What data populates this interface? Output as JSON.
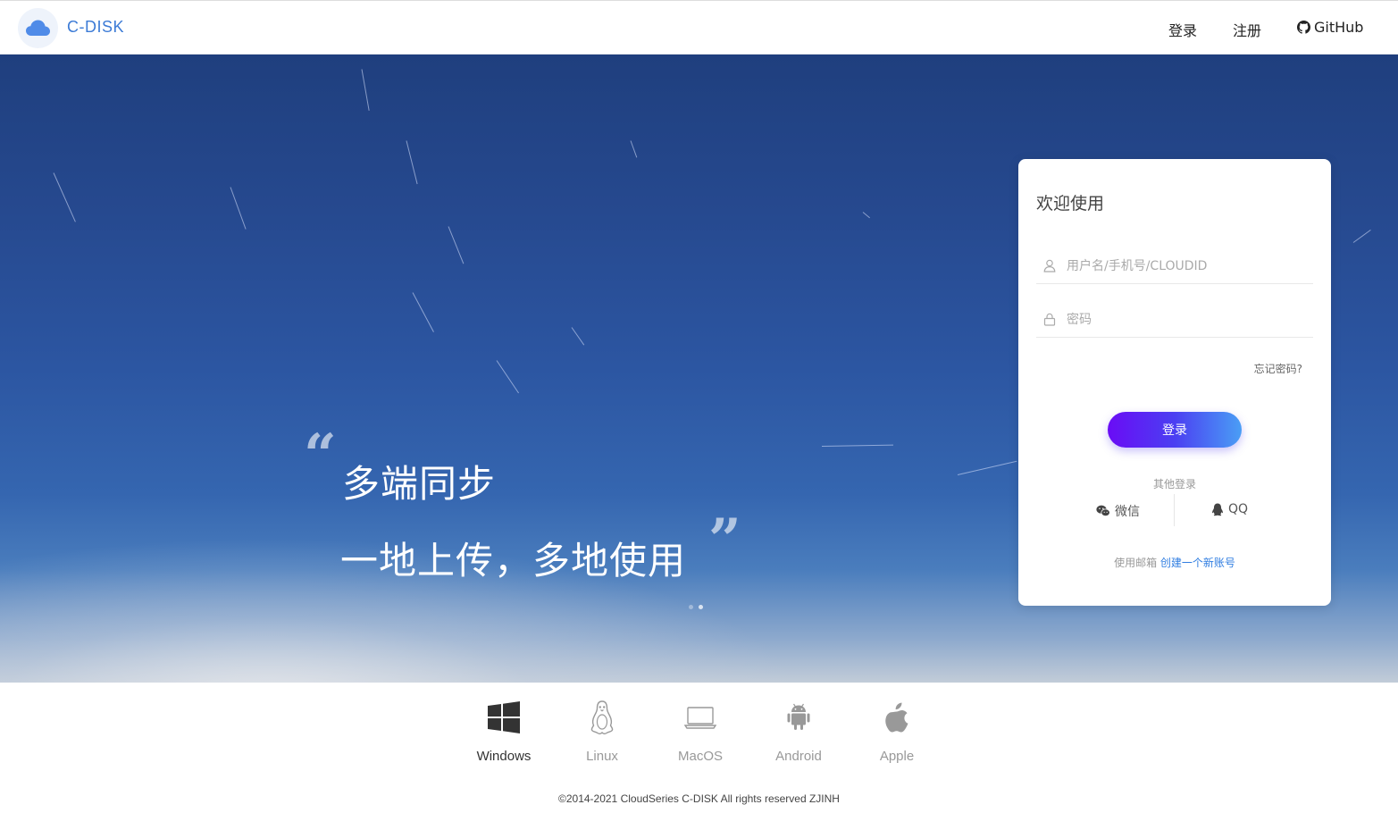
{
  "header": {
    "brand": "C-DISK",
    "logo_icon": "cloud-icon",
    "nav": {
      "login": "登录",
      "register": "注册",
      "github": "GitHub"
    }
  },
  "hero": {
    "slogan_line1": "多端同步",
    "slogan_line2": "一地上传，多地使用",
    "quote_open": "“",
    "quote_close": "”",
    "slide_count": 2,
    "active_slide": 2
  },
  "login_card": {
    "title": "欢迎使用",
    "username_placeholder": "用户名/手机号/CLOUDID",
    "password_placeholder": "密码",
    "forgot_password": "忘记密码?",
    "login_button": "登录",
    "other_login_label": "其他登录",
    "social": {
      "wechat": "微信",
      "qq": "QQ"
    },
    "signup_prefix": "使用邮箱",
    "signup_link": "创建一个新账号"
  },
  "platforms": [
    {
      "label": "Windows",
      "icon": "windows-icon",
      "active": true
    },
    {
      "label": "Linux",
      "icon": "linux-icon",
      "active": false
    },
    {
      "label": "MacOS",
      "icon": "laptop-icon",
      "active": false
    },
    {
      "label": "Android",
      "icon": "android-icon",
      "active": false
    },
    {
      "label": "Apple",
      "icon": "apple-icon",
      "active": false
    }
  ],
  "footer": "©2014-2021 CloudSeries C-DISK All rights reserved ZJINH",
  "colors": {
    "brand": "#3c7bd6",
    "link": "#2f7de1",
    "button_gradient_start": "#6a0cf5",
    "button_gradient_end": "#4a9ef5"
  }
}
